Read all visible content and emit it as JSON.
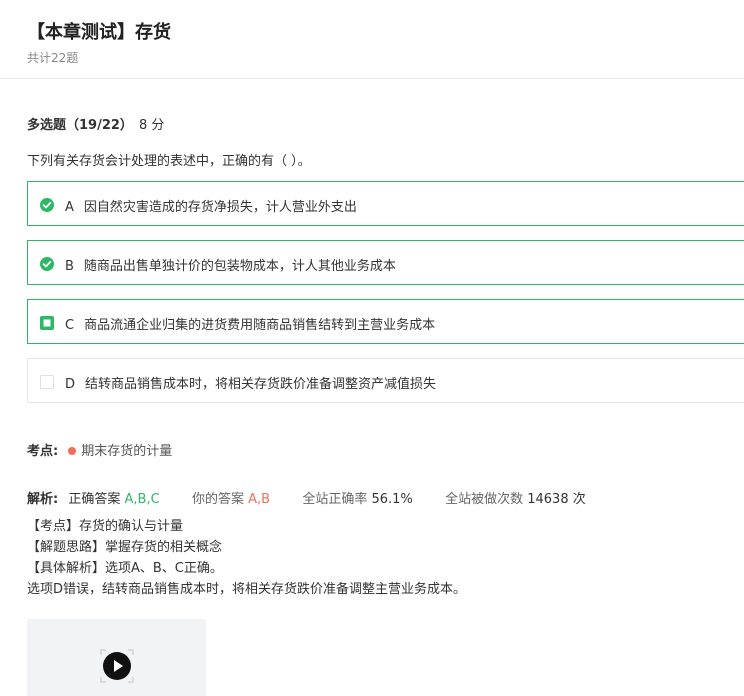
{
  "header": {
    "title": "【本章测试】存货",
    "subtitle": "共计22题"
  },
  "question": {
    "type_label": "多选题（19/22）",
    "score": "8 分",
    "text": "下列有关存货会计处理的表述中，正确的有（ ）。",
    "options": [
      {
        "letter": "A",
        "text": "因自然灾害造成的存货净损失，计人营业外支出",
        "state": "correct-selected"
      },
      {
        "letter": "B",
        "text": "随商品出售单独计价的包装物成本，计人其他业务成本",
        "state": "correct-selected"
      },
      {
        "letter": "C",
        "text": "商品流通企业归集的进货费用随商品销售结转到主营业务成本",
        "state": "correct-missed"
      },
      {
        "letter": "D",
        "text": "结转商品销售成本时，将相关存货跌价准备调整资产减值损失",
        "state": "unselected"
      }
    ]
  },
  "knowledge": {
    "label": "考点:",
    "point": "期末存货的计量"
  },
  "analysis": {
    "label": "解析:",
    "correct_label": "正确答案",
    "correct_value": "A,B,C",
    "your_label": "你的答案",
    "your_value": "A,B",
    "rate_label": "全站正确率",
    "rate_value": "56.1%",
    "count_label": "全站被做次数",
    "count_value": "14638",
    "count_unit": "次",
    "lines": [
      "【考点】存货的确认与计量",
      "【解题思路】掌握存货的相关概念",
      "【具体解析】选项A、B、C正确。",
      "选项D错误，结转商品销售成本时，将相关存货跌价准备调整主营业务成本。"
    ]
  },
  "colors": {
    "accent_green": "#2db866",
    "error_red": "#f26e5a"
  }
}
